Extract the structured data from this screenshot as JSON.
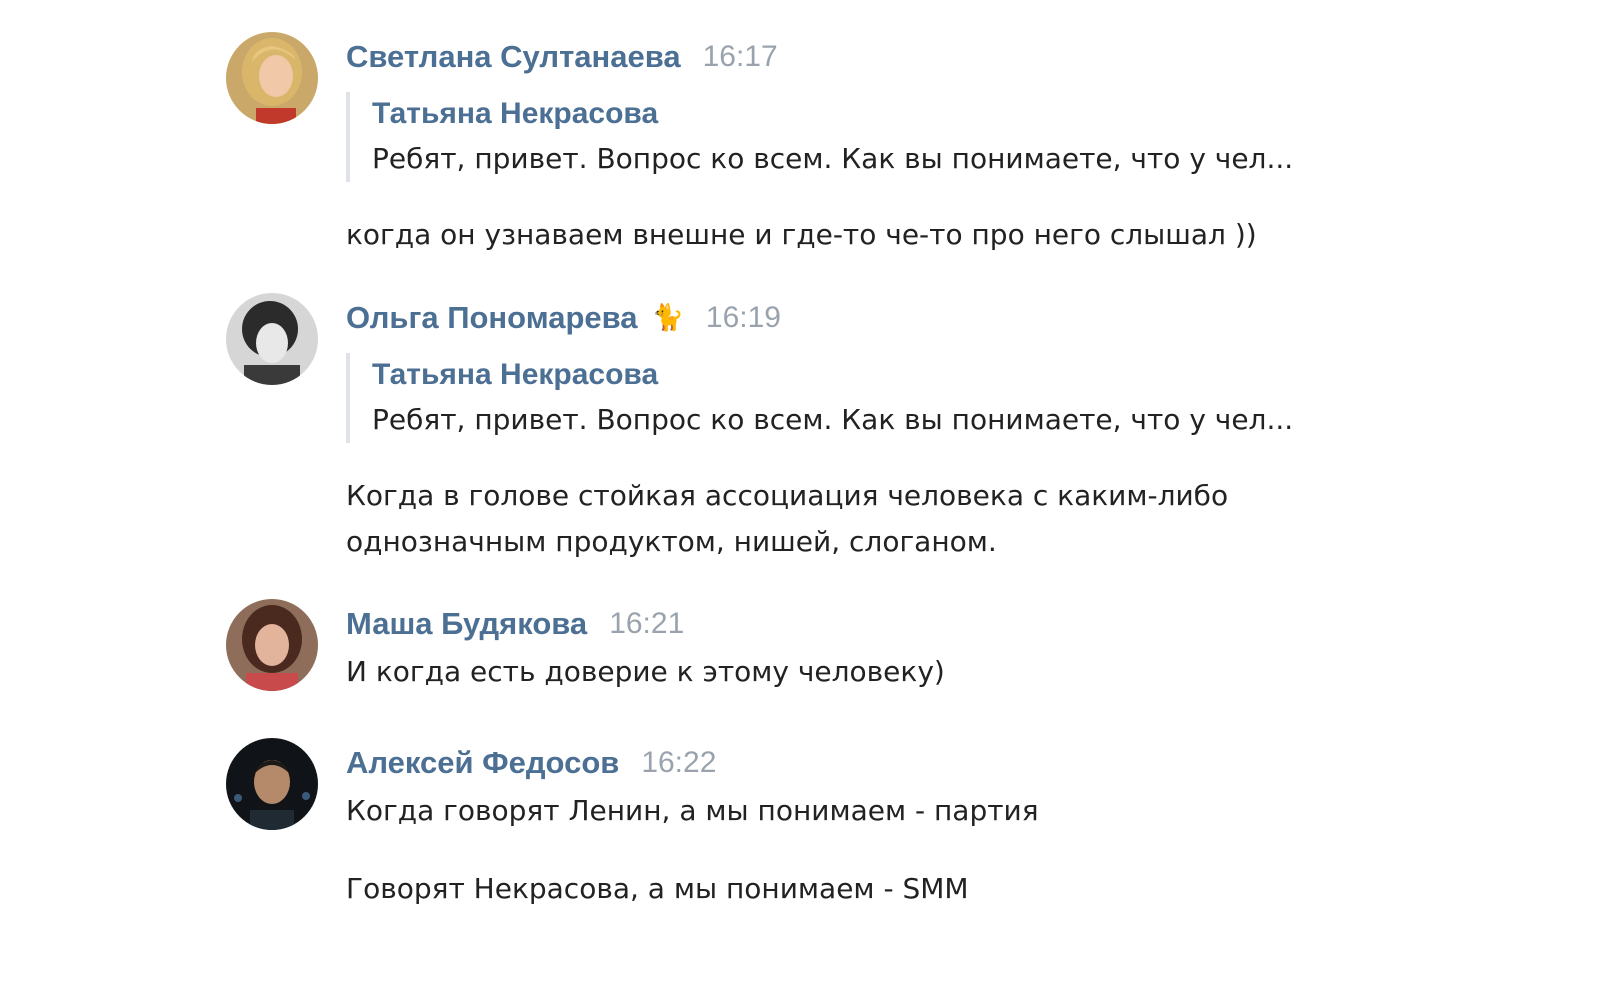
{
  "messages": [
    {
      "author": "Светлана Султанаева",
      "time": "16:17",
      "avatar": "avatar-photo-woman-blonde",
      "quote": {
        "author": "Татьяна Некрасова",
        "text": "Ребят, привет. Вопрос ко всем. Как вы понимаете, что у чел..."
      },
      "texts": [
        "когда он узнаваем внешне и где-то че-то про него слышал ))"
      ]
    },
    {
      "author": "Ольга Пономарева",
      "emoji": "🐈",
      "time": "16:19",
      "avatar": "avatar-photo-woman-bw",
      "quote": {
        "author": "Татьяна Некрасова",
        "text": "Ребят, привет. Вопрос ко всем. Как вы понимаете, что у чел..."
      },
      "texts": [
        "Когда в голове стойкая ассоциация человека с каким-либо\nоднозначным продуктом, нишей, слоганом."
      ]
    },
    {
      "author": "Маша Будякова",
      "time": "16:21",
      "avatar": "avatar-photo-woman-dark-hair",
      "texts": [
        "И когда есть доверие к этому человеку)"
      ]
    },
    {
      "author": "Алексей Федосов",
      "time": "16:22",
      "avatar": "avatar-photo-man-dark",
      "texts": [
        "Когда говорят Ленин, а мы понимаем - партия",
        "Говорят Некрасова, а мы понимаем - SMM"
      ]
    }
  ],
  "colors": {
    "author_link": "#4c6f94",
    "timestamp": "#9aa3ad",
    "text": "#222222",
    "quote_bar": "#dfe3e8"
  }
}
